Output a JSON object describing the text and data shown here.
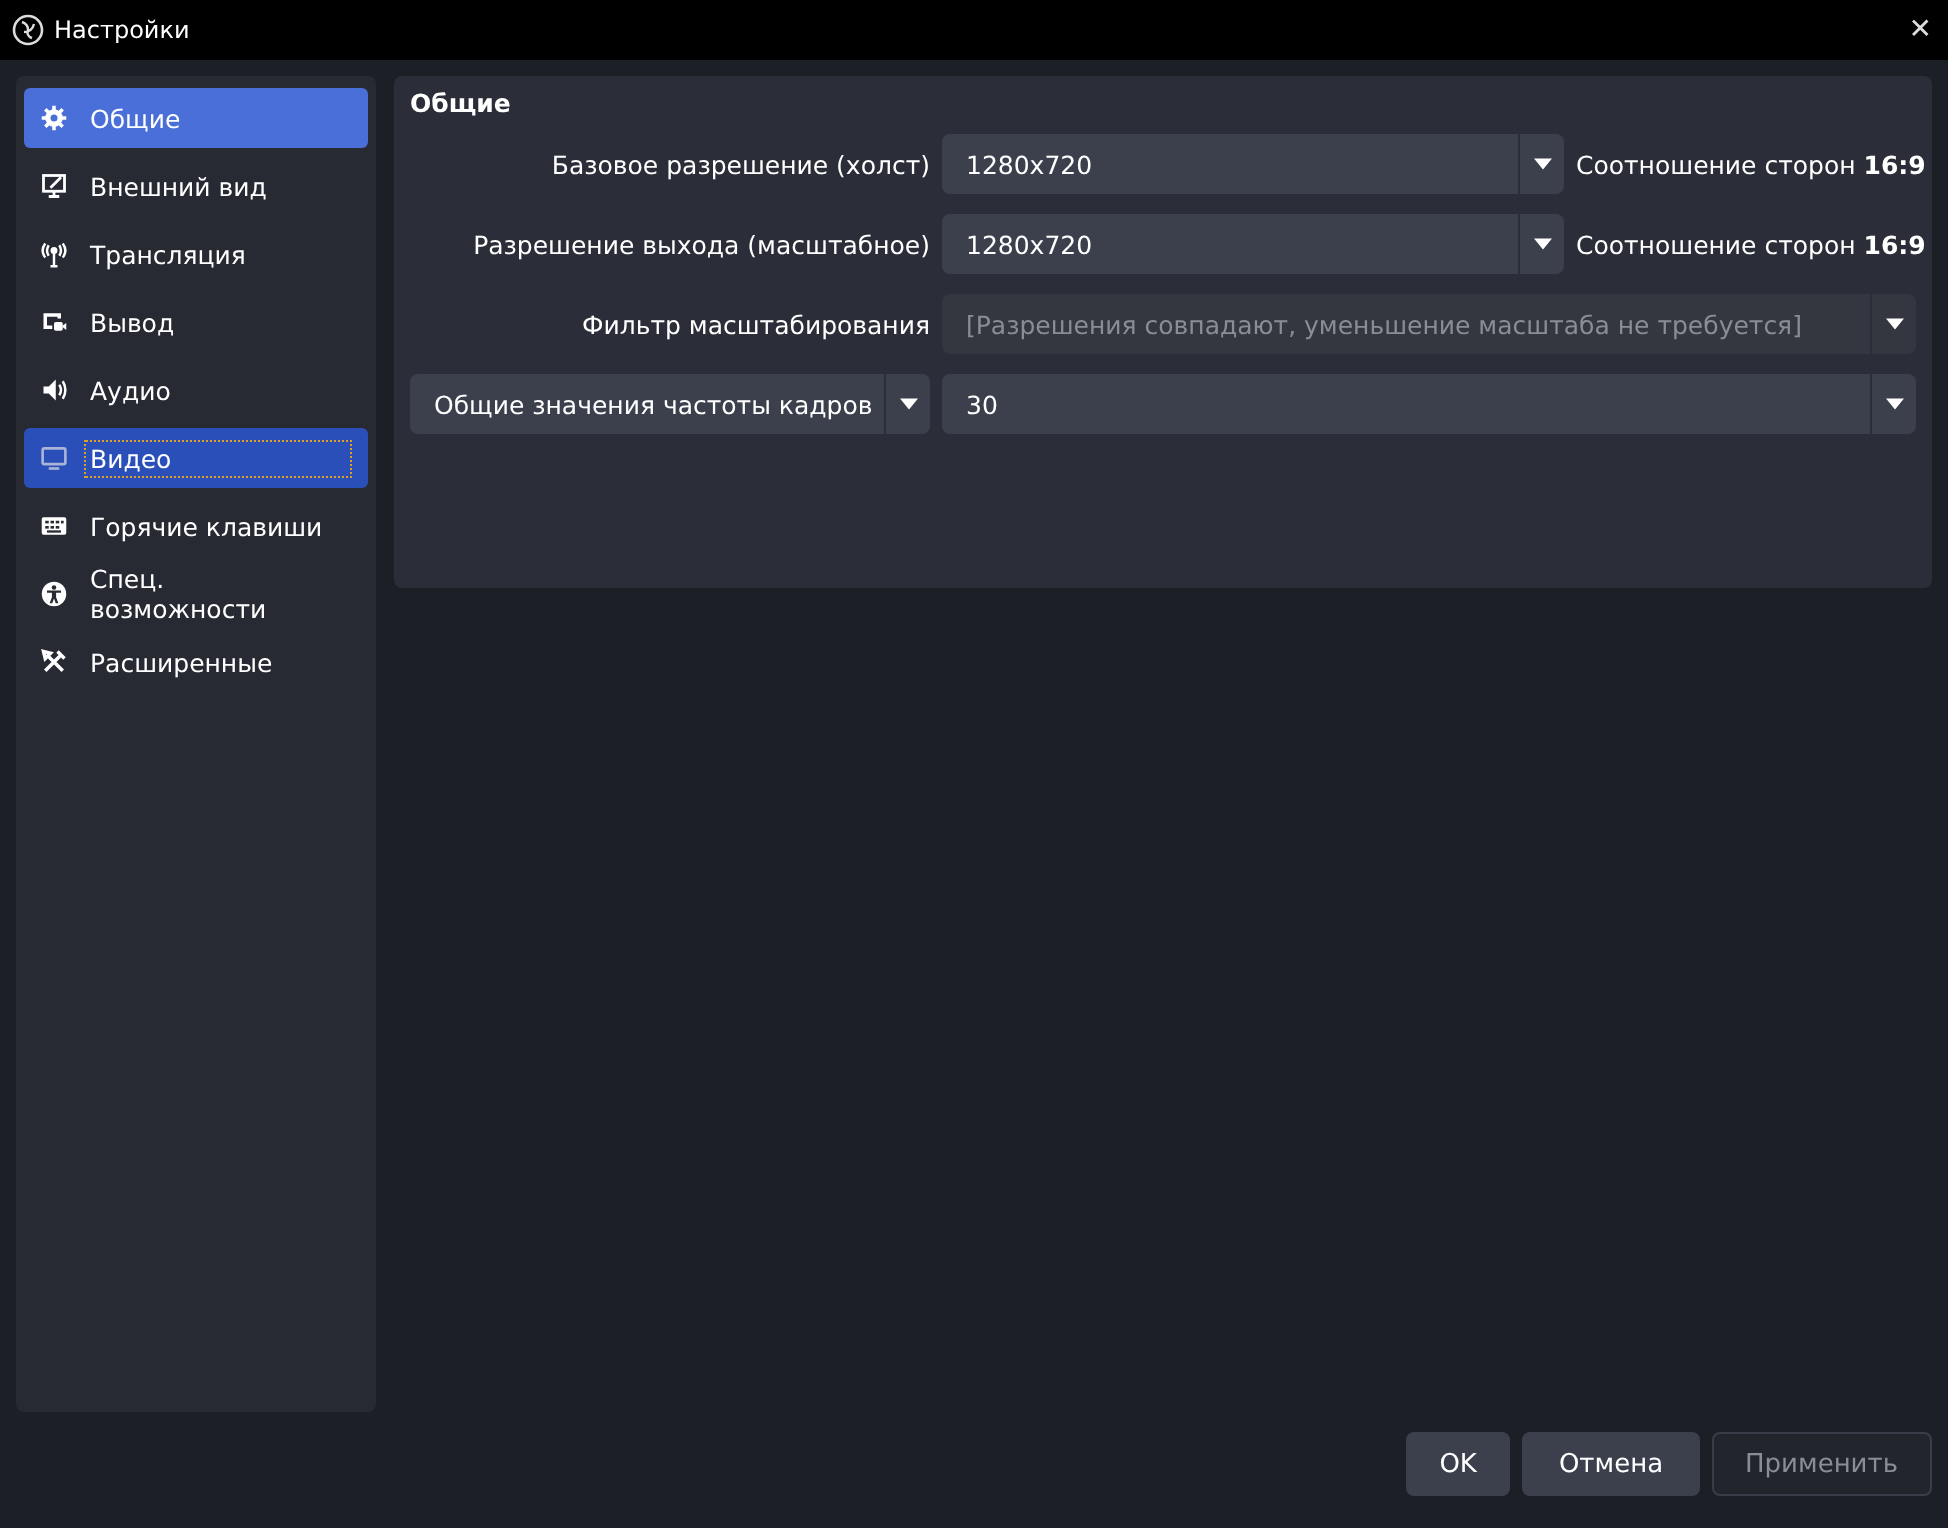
{
  "window": {
    "title": "Настройки",
    "close": "✕"
  },
  "sidebar": {
    "items": [
      {
        "label": "Общие",
        "selected": false,
        "highlighted": true
      },
      {
        "label": "Внешний вид",
        "selected": false,
        "highlighted": false
      },
      {
        "label": "Трансляция",
        "selected": false,
        "highlighted": false
      },
      {
        "label": "Вывод",
        "selected": false,
        "highlighted": false
      },
      {
        "label": "Аудио",
        "selected": false,
        "highlighted": false
      },
      {
        "label": "Видео",
        "selected": true,
        "highlighted": false
      },
      {
        "label": "Горячие клавиши",
        "selected": false,
        "highlighted": false
      },
      {
        "label": "Спец. возможности",
        "selected": false,
        "highlighted": false
      },
      {
        "label": "Расширенные",
        "selected": false,
        "highlighted": false
      }
    ]
  },
  "section": {
    "title": "Общие",
    "rows": [
      {
        "kind": "combo",
        "label": "Базовое разрешение (холст)",
        "value": "1280x720",
        "disabled": false,
        "note": "Соотношение сторон **16:9**"
      },
      {
        "kind": "combo",
        "label": "Разрешение выхода (масштабное)",
        "value": "1280x720",
        "disabled": false,
        "note": "Соотношение сторон **16:9**"
      },
      {
        "kind": "combo",
        "label": "Фильтр масштабирования",
        "value": "[Разрешения совпадают, уменьшение масштаба не требуется]",
        "disabled": true
      },
      {
        "kind": "dropdown_label",
        "label": "Общие значения частоты кадров",
        "value": "30",
        "disabled": false
      }
    ]
  },
  "buttons": [
    {
      "label": "OK",
      "disabled": false
    },
    {
      "label": "Отмена",
      "disabled": false
    },
    {
      "label": "Применить",
      "disabled": true
    }
  ]
}
